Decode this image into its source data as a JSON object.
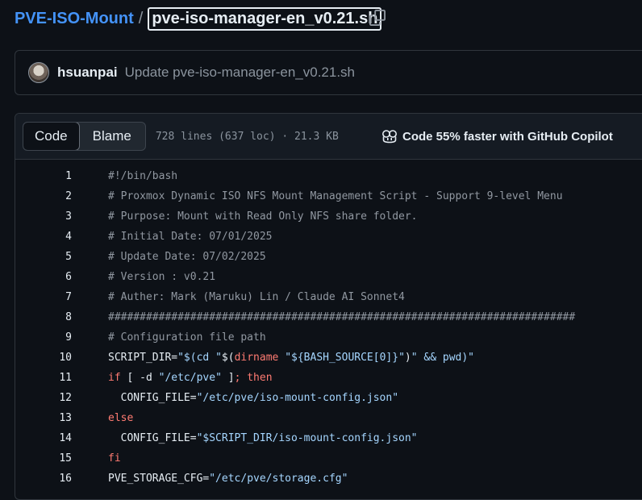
{
  "breadcrumb": {
    "repo": "PVE-ISO-Mount",
    "separator": "/",
    "file": "pve-iso-manager-en_v0.21.sh"
  },
  "commit": {
    "author": "hsuanpai",
    "message": "Update pve-iso-manager-en_v0.21.sh"
  },
  "file_header": {
    "tabs": [
      "Code",
      "Blame"
    ],
    "active_tab": "Code",
    "stats": "728 lines (637 loc) · 21.3 KB",
    "copilot": "Code 55% faster with GitHub Copilot"
  },
  "code_lines": [
    {
      "n": "1",
      "text": "#!/bin/bash"
    },
    {
      "n": "2",
      "text": "# Proxmox Dynamic ISO NFS Mount Management Script - Support 9-level Menu"
    },
    {
      "n": "3",
      "text": "# Purpose: Mount with Read Only NFS share folder."
    },
    {
      "n": "4",
      "text": "# Initial Date: 07/01/2025"
    },
    {
      "n": "5",
      "text": "# Update Date: 07/02/2025"
    },
    {
      "n": "6",
      "text": "# Version : v0.21"
    },
    {
      "n": "7",
      "text": "# Auther: Mark (Maruku) Lin / Claude AI Sonnet4"
    },
    {
      "n": "8",
      "text": "##########################################################################"
    },
    {
      "n": "9",
      "text": "# Configuration file path"
    },
    {
      "n": "10",
      "text": "SCRIPT_DIR=\"$(cd \"$(dirname \"${BASH_SOURCE[0]}\")\" && pwd)\""
    },
    {
      "n": "11",
      "text": "if [ -d \"/etc/pve\" ]; then"
    },
    {
      "n": "12",
      "text": "  CONFIG_FILE=\"/etc/pve/iso-mount-config.json\""
    },
    {
      "n": "13",
      "text": "else"
    },
    {
      "n": "14",
      "text": "  CONFIG_FILE=\"$SCRIPT_DIR/iso-mount-config.json\""
    },
    {
      "n": "15",
      "text": "fi"
    },
    {
      "n": "16",
      "text": "PVE_STORAGE_CFG=\"/etc/pve/storage.cfg\""
    }
  ]
}
